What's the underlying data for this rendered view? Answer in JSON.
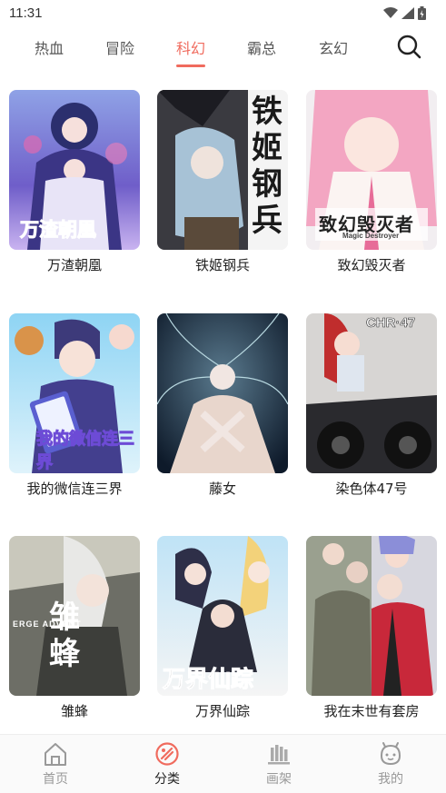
{
  "status": {
    "time": "11:31"
  },
  "tabs": [
    {
      "label": "热血"
    },
    {
      "label": "冒险"
    },
    {
      "label": "科幻"
    },
    {
      "label": "霸总"
    },
    {
      "label": "玄幻"
    }
  ],
  "active_tab": "科幻",
  "comics": [
    {
      "title": "万渣朝凰",
      "cover_text": "万渣朝凰"
    },
    {
      "title": "铁姬钢兵",
      "cover_text": "铁姬钢兵"
    },
    {
      "title": "致幻毁灭者",
      "cover_text": "致幻毁灭者",
      "cover_subtext": "Magic Destroyer"
    },
    {
      "title": "我的微信连三界",
      "cover_text": "我的微信连三界"
    },
    {
      "title": "藤女"
    },
    {
      "title": "染色体47号",
      "cover_text": "CHR·47"
    },
    {
      "title": "雏蜂",
      "cover_text": "雏蜂",
      "cover_subtext": "ERGE ADVENT"
    },
    {
      "title": "万界仙踪",
      "cover_text": "万界仙踪"
    },
    {
      "title": "我在末世有套房"
    }
  ],
  "nav": [
    {
      "label": "首页",
      "icon": "home-icon"
    },
    {
      "label": "分类",
      "icon": "category-icon"
    },
    {
      "label": "画架",
      "icon": "shelf-icon"
    },
    {
      "label": "我的",
      "icon": "profile-icon"
    }
  ],
  "active_nav": "分类",
  "colors": {
    "accent": "#f06b5e",
    "inactive": "#999999"
  }
}
